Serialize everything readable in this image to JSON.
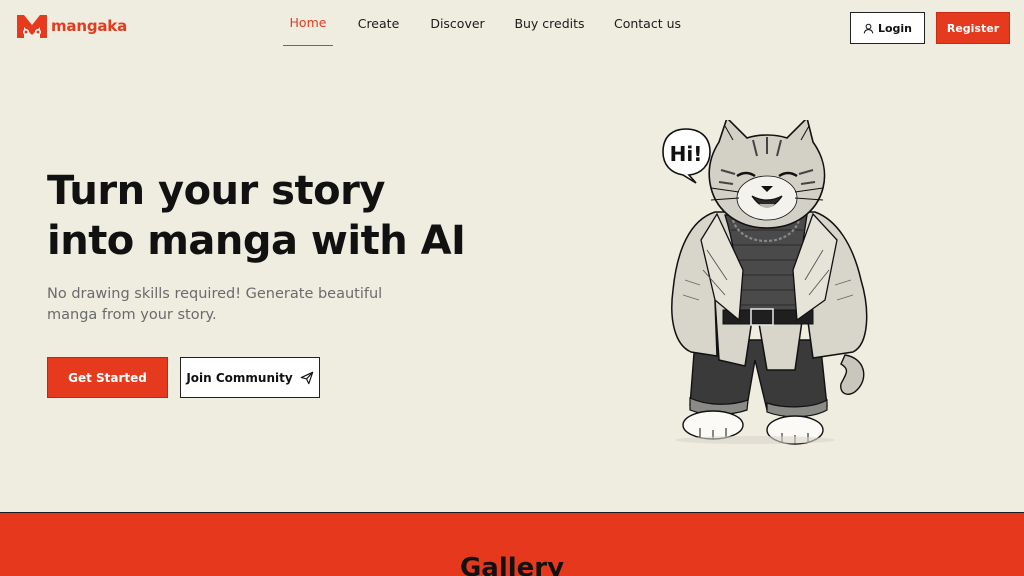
{
  "brand": {
    "name": "mangaka",
    "color": "#e63a1f",
    "icon": "mangaka-logo-icon"
  },
  "nav": {
    "items": [
      {
        "label": "Home",
        "active": true
      },
      {
        "label": "Create",
        "active": false
      },
      {
        "label": "Discover",
        "active": false
      },
      {
        "label": "Buy credits",
        "active": false
      },
      {
        "label": "Contact us",
        "active": false
      }
    ]
  },
  "auth": {
    "login_label": "Login",
    "login_icon": "user-icon",
    "register_label": "Register"
  },
  "hero": {
    "title_line1": "Turn your story",
    "title_line2": "into manga with AI",
    "subtitle": "No drawing skills required! Generate beautiful manga from your story.",
    "cta_primary": "Get Started",
    "cta_secondary": "Join Community",
    "cta_secondary_icon": "send-icon",
    "illustration": {
      "speech_bubble": "Hi!",
      "subject": "cat-mascot-illustration"
    }
  },
  "gallery": {
    "title": "Gallery"
  },
  "colors": {
    "background": "#efece0",
    "accent": "#e63a1f",
    "text": "#111111",
    "muted": "#6b6b6b"
  }
}
